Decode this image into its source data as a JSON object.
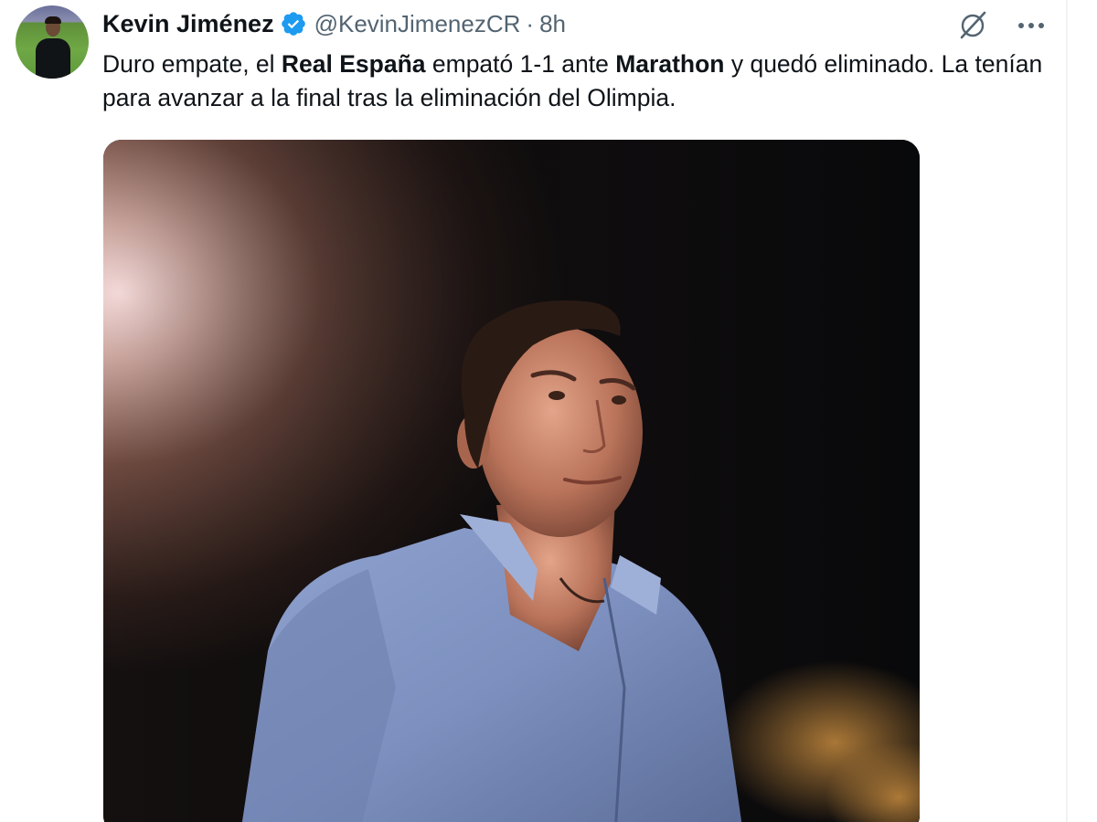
{
  "author": {
    "display_name": "Kevin Jiménez",
    "handle": "@KevinJimenezCR",
    "separator": "·",
    "time": "8h",
    "verified": true,
    "verified_color": "#1d9bf0"
  },
  "header_icons": {
    "grok": "grok-slash-icon",
    "more": "more-options-icon"
  },
  "tweet": {
    "segments": [
      {
        "text": "Duro empate, el ",
        "bold": false
      },
      {
        "text": "Real España",
        "bold": true
      },
      {
        "text": " empató 1-1 ante ",
        "bold": false
      },
      {
        "text": "Marathon",
        "bold": true
      },
      {
        "text": " y quedó eliminado. La tenían para avanzar a la final tras la eliminación del Olimpia.",
        "bold": false
      }
    ]
  },
  "media": {
    "type": "photo"
  },
  "colors": {
    "text_primary": "#0f1419",
    "text_secondary": "#536471",
    "accent": "#1d9bf0"
  }
}
